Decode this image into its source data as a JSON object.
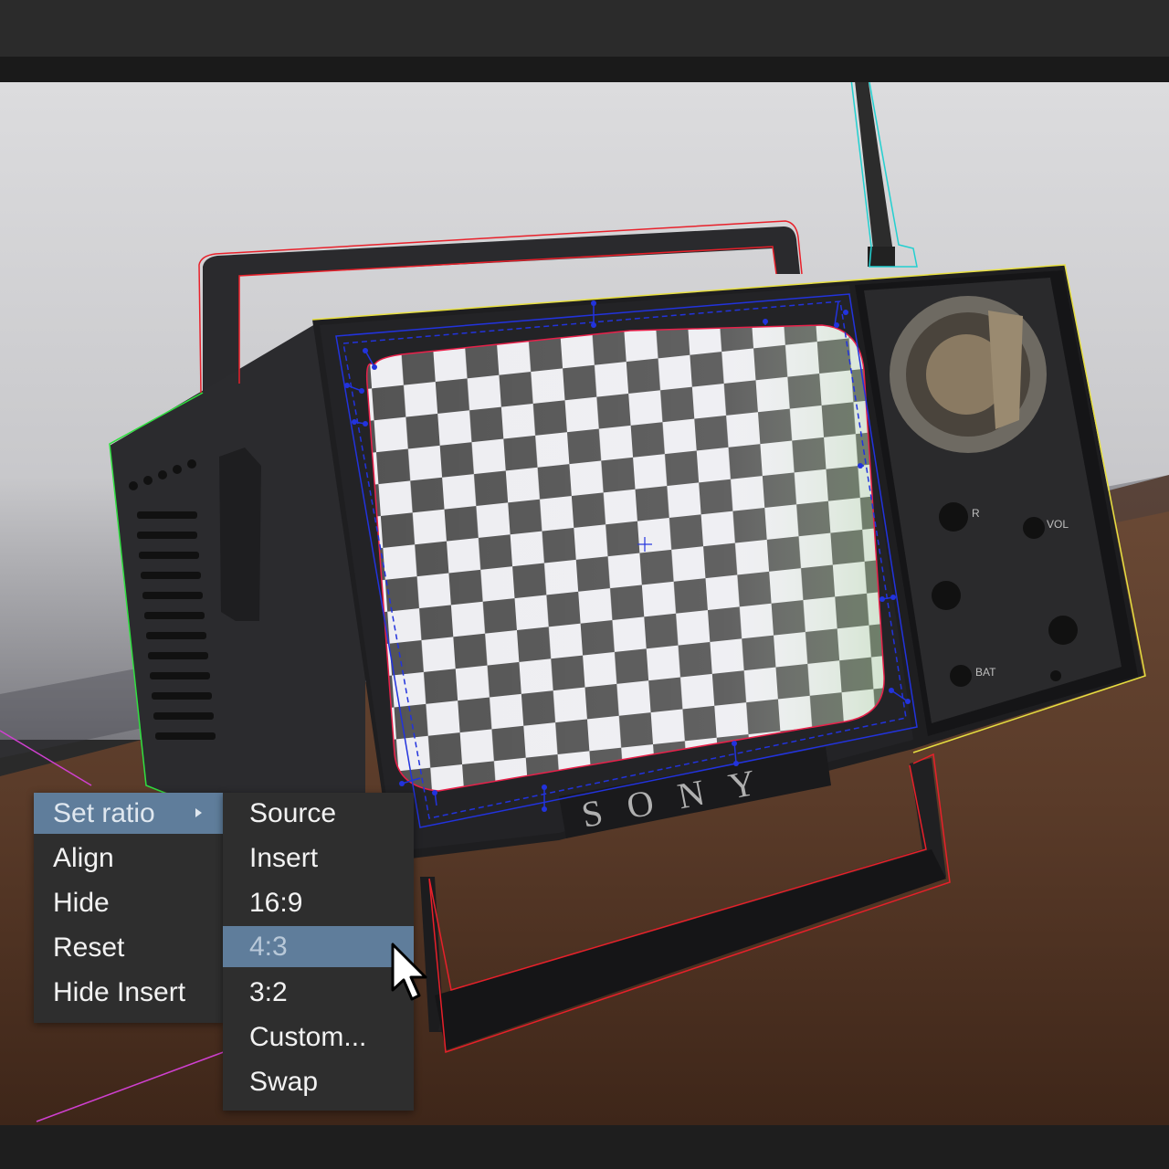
{
  "context_menu": {
    "items": [
      {
        "label": "Set ratio",
        "has_submenu": true,
        "selected": true
      },
      {
        "label": "Align"
      },
      {
        "label": "Hide"
      },
      {
        "label": "Reset"
      },
      {
        "label": "Hide Insert"
      }
    ]
  },
  "ratio_submenu": {
    "items": [
      {
        "label": "Source"
      },
      {
        "label": "Insert"
      },
      {
        "label": "16:9"
      },
      {
        "label": "4:3",
        "hovered": true
      },
      {
        "label": "3:2"
      },
      {
        "label": "Custom..."
      },
      {
        "label": "Swap"
      }
    ]
  },
  "canvas": {
    "brand_text": "SONY",
    "control_labels": [
      "R",
      "VOL",
      "BAT"
    ]
  },
  "colors": {
    "menu_bg": "#2e2e2e",
    "menu_highlight": "#5f7d9b",
    "menu_text": "#f2f2f2",
    "handle_outline": "#e8202a",
    "screen_outline": "#2233dd",
    "antenna_outline": "#22d0d0",
    "body_outline": "#e8e040",
    "side_outline": "#30e040",
    "guide_line": "#d040d0"
  },
  "icons": {
    "cursor": "arrow-pointer-icon",
    "submenu": "triangle-right-icon",
    "center_marker": "crosshair-icon"
  }
}
